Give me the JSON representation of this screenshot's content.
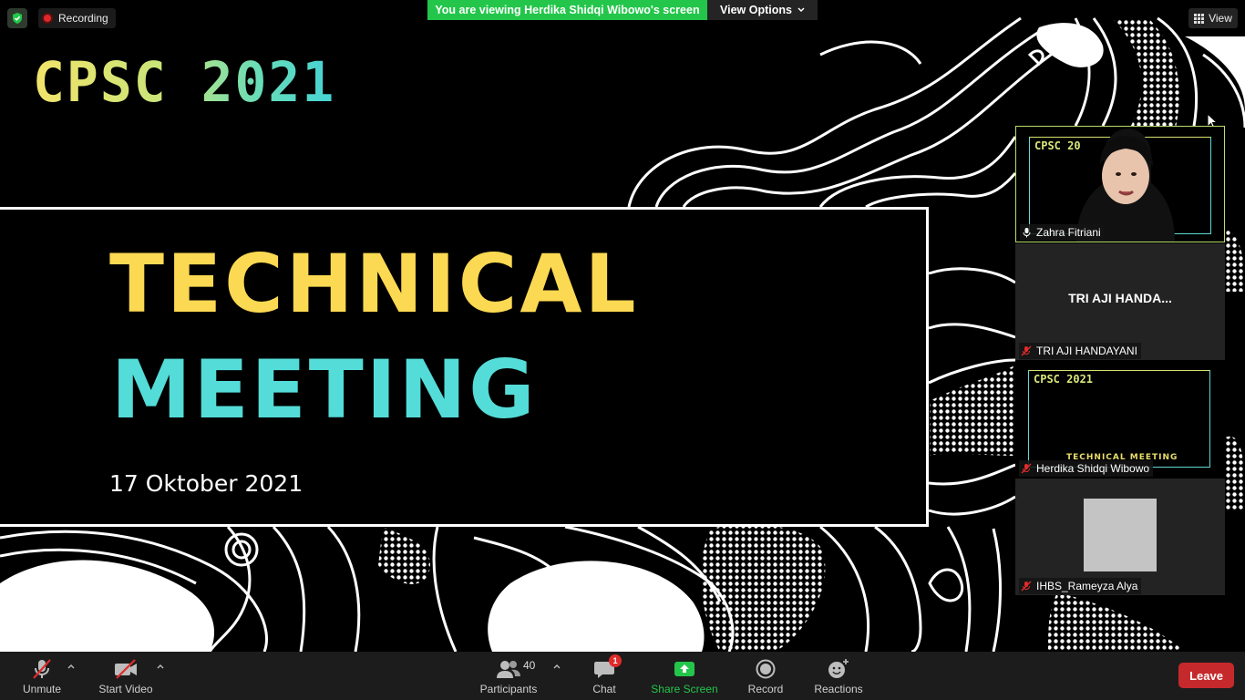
{
  "top_bar": {
    "recording_label": "Recording",
    "viewing_banner": "You are viewing Herdika Shidqi Wibowo's screen",
    "view_options_label": "View Options",
    "view_label": "View"
  },
  "slide": {
    "logo_text": "CPSC 2021",
    "title_line1": "TECHNICAL",
    "title_line2": "MEETING",
    "date": "17 Oktober 2021",
    "colors": {
      "title_yellow": "#fcd952",
      "title_cyan": "#54dcd8"
    }
  },
  "participants_panel": {
    "tiles": [
      {
        "name": "Zahra Fitriani",
        "status": "speaking",
        "mini_logo": "CPSC 20"
      },
      {
        "name": "TRI AJI HANDAYANI",
        "display_placeholder": "TRI AJI HANDA...",
        "status": "muted"
      },
      {
        "name": "Herdika Shidqi Wibowo",
        "status": "muted",
        "mini_logo": "CPSC 2021",
        "mini_text": "TECHNICAL MEETING"
      },
      {
        "name": "IHBS_Rameyza Alya",
        "status": "muted"
      }
    ]
  },
  "toolbar": {
    "unmute_label": "Unmute",
    "start_video_label": "Start Video",
    "participants_label": "Participants",
    "participants_count": "40",
    "chat_label": "Chat",
    "chat_badge": "1",
    "share_screen_label": "Share Screen",
    "record_label": "Record",
    "reactions_label": "Reactions",
    "leave_label": "Leave",
    "colors": {
      "share_green": "#23c64a",
      "leave_red": "#c5292b"
    }
  }
}
